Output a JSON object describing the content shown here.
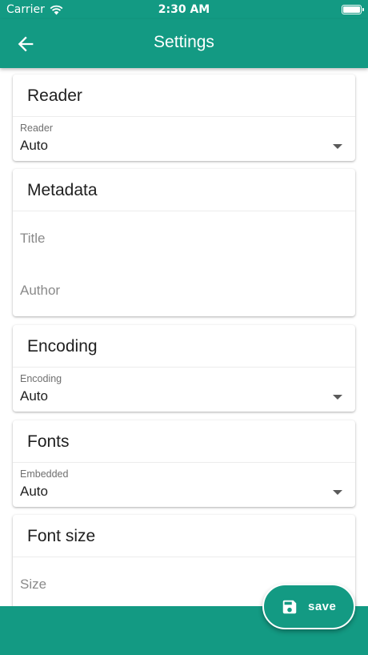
{
  "status_bar": {
    "carrier": "Carrier",
    "time": "2:30 AM"
  },
  "app_bar": {
    "title": "Settings"
  },
  "sections": {
    "reader": {
      "title": "Reader",
      "field_label": "Reader",
      "value": "Auto"
    },
    "metadata": {
      "title": "Metadata",
      "title_placeholder": "Title",
      "author_placeholder": "Author"
    },
    "encoding": {
      "title": "Encoding",
      "field_label": "Encoding",
      "value": "Auto"
    },
    "fonts": {
      "title": "Fonts",
      "field_label": "Embedded",
      "value": "Auto"
    },
    "font_size": {
      "title": "Font size",
      "size_placeholder": "Size"
    }
  },
  "fab": {
    "label": "save",
    "icon": "save-icon"
  },
  "colors": {
    "primary": "#139a83",
    "surface": "#ffffff"
  }
}
